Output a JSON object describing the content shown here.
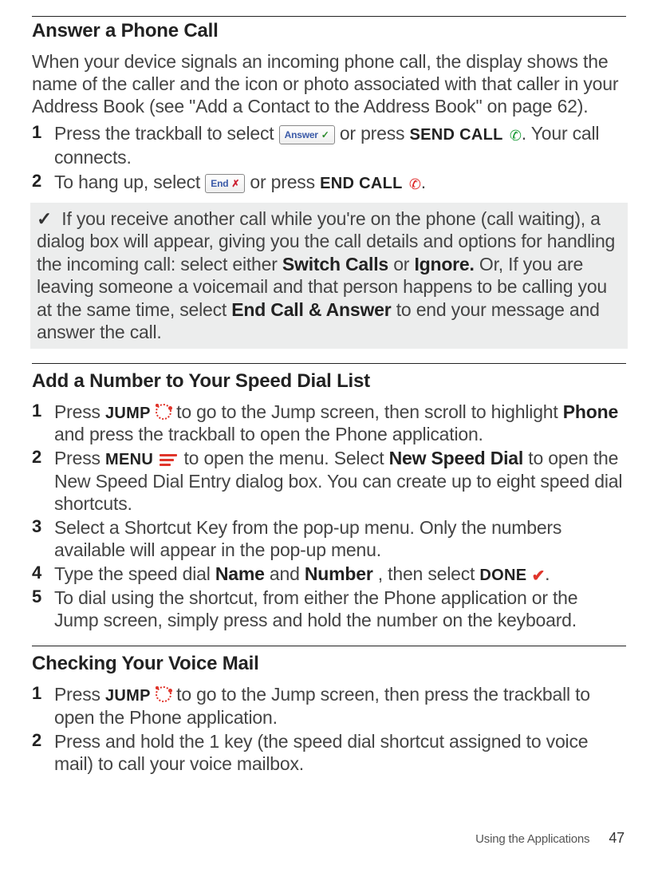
{
  "section1": {
    "heading": "Answer a Phone Call",
    "intro": "When your device signals an incoming phone call, the display shows the name of the caller and the icon or photo associated with that caller in your Address Book (see \"Add a Contact to the Address Book\" on page 62).",
    "steps": {
      "1": {
        "num": "1",
        "lead": "Press the trackball to select ",
        "btn_answer": "Answer",
        "mid": " or press ",
        "send_label": "SEND CALL",
        "tail": ". Your call connects."
      },
      "2": {
        "num": "2",
        "lead": "To hang up, select ",
        "btn_end": "End",
        "mid": " or press ",
        "end_label": "END CALL",
        "tail": "."
      }
    },
    "tip": {
      "pre": "If you receive another call while you're on the phone (call waiting), a dialog box will appear, giving you the call details and options for handling the incoming call: select either ",
      "switch": "Switch Calls",
      "or": " or ",
      "ignore": "Ignore.",
      "mid": "  Or, If you are leaving someone a voicemail and that person happens to be calling you at the same time, select ",
      "endanswer": "End Call & Answer",
      "post": " to end your message and answer the call."
    }
  },
  "section2": {
    "heading": "Add a Number to Your Speed Dial List",
    "steps": {
      "1": {
        "num": "1",
        "lead": "Press ",
        "jump": "JUMP",
        "mid": " to go to the Jump screen, then scroll to highlight ",
        "phone": "Phone",
        "tail": " and press the trackball to open the Phone application."
      },
      "2": {
        "num": "2",
        "lead": "Press ",
        "menu": "MENU",
        "mid": " to open the menu. Select ",
        "newspeed": "New Speed Dial",
        "tail": " to open the New Speed Dial Entry dialog box. You can create up to eight speed dial shortcuts."
      },
      "3": {
        "num": "3",
        "text": "Select a Shortcut Key from the pop-up menu. Only the numbers available will appear in the pop-up menu."
      },
      "4": {
        "num": "4",
        "lead": "Type the speed dial ",
        "name": "Name",
        "and": " and ",
        "number": "Number",
        "mid": ", then select ",
        "done": "DONE",
        "tail": "."
      },
      "5": {
        "num": "5",
        "text": "To dial using the shortcut, from either the Phone application or the Jump screen, simply press and hold the number on the keyboard."
      }
    }
  },
  "section3": {
    "heading": "Checking Your Voice Mail",
    "steps": {
      "1": {
        "num": "1",
        "lead": "Press ",
        "jump": "JUMP",
        "tail": " to go to the Jump screen, then press the trackball to open the Phone application."
      },
      "2": {
        "num": "2",
        "text": "Press and hold the 1 key (the speed dial shortcut assigned to voice mail) to call your voice mailbox."
      }
    }
  },
  "footer": {
    "section": "Using the Applications",
    "page": "47"
  }
}
